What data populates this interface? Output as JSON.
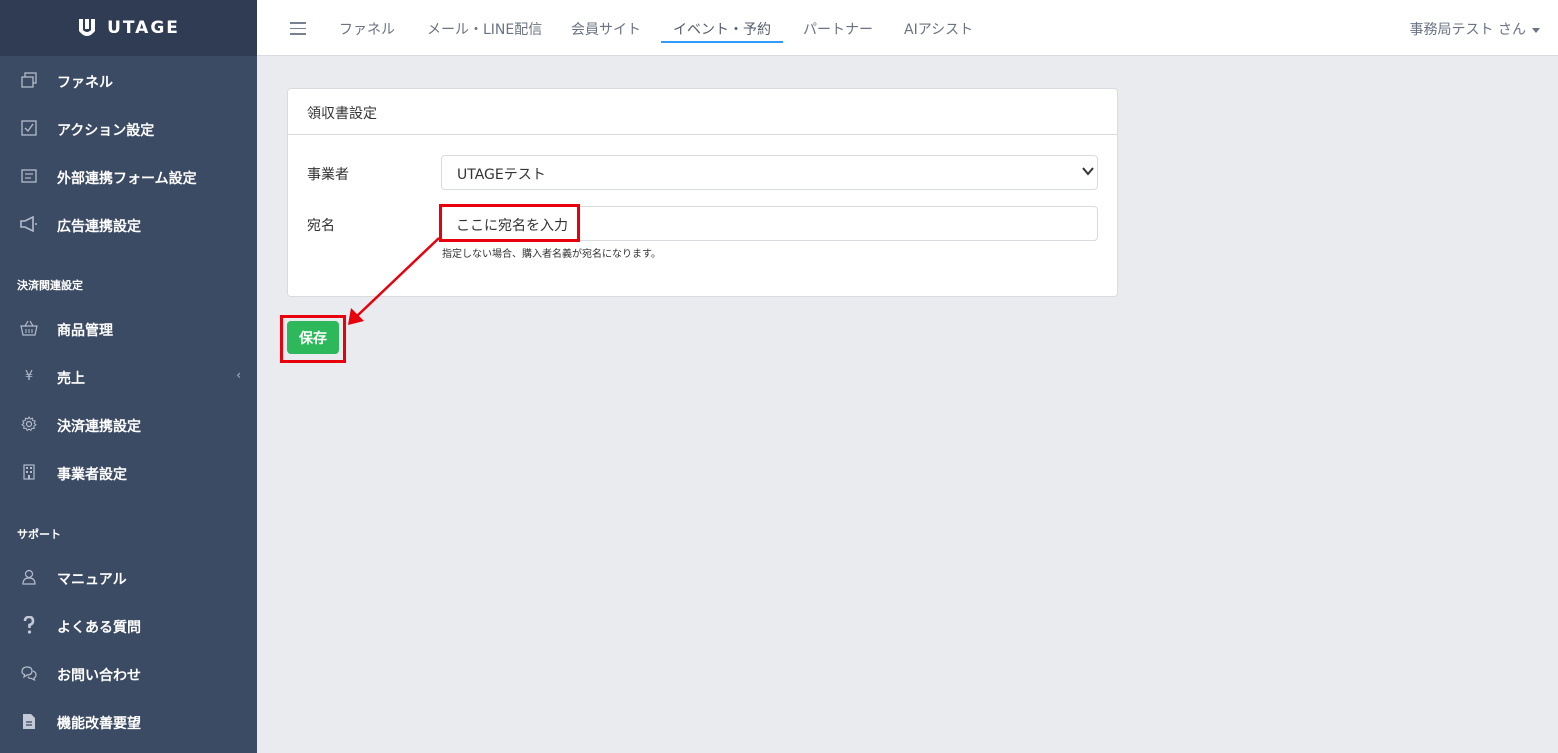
{
  "brand": {
    "name": "UTAGE"
  },
  "colors": {
    "sidebar": "#3c4b64",
    "brand_bar": "#303c54",
    "accent": "#3399ff",
    "success": "#2eb85c",
    "annotation": "#e8000d"
  },
  "sidebar": {
    "items": [
      {
        "label": "ファネル",
        "icon": "copy-icon"
      },
      {
        "label": "アクション設定",
        "icon": "checkbox-icon"
      },
      {
        "label": "外部連携フォーム設定",
        "icon": "form-icon"
      },
      {
        "label": "広告連携設定",
        "icon": "megaphone-icon"
      }
    ],
    "section_payment": "決済関連設定",
    "payment_items": [
      {
        "label": "商品管理",
        "icon": "basket-icon"
      },
      {
        "label": "売上",
        "icon": "yen-icon"
      },
      {
        "label": "決済連携設定",
        "icon": "gear-icon"
      },
      {
        "label": "事業者設定",
        "icon": "building-icon"
      }
    ],
    "section_support": "サポート",
    "support_items": [
      {
        "label": "マニュアル",
        "icon": "user-icon"
      },
      {
        "label": "よくある質問",
        "icon": "question-icon"
      },
      {
        "label": "お問い合わせ",
        "icon": "chat-icon"
      },
      {
        "label": "機能改善要望",
        "icon": "document-icon"
      }
    ],
    "yen_symbol": "¥",
    "chevron": "‹"
  },
  "header": {
    "tabs": [
      "ファネル",
      "メール・LINE配信",
      "会員サイト",
      "イベント・予約",
      "パートナー",
      "AIアシスト"
    ],
    "active_tab": "イベント・予約",
    "user": "事務局テスト さん"
  },
  "card": {
    "title": "領収書設定",
    "business_label": "事業者",
    "business_value": "UTAGEテスト",
    "addressee_label": "宛名",
    "addressee_placeholder": "ここに宛名を入力",
    "help_text": "指定しない場合、購入者名義が宛名になります。"
  },
  "save_button": "保存"
}
